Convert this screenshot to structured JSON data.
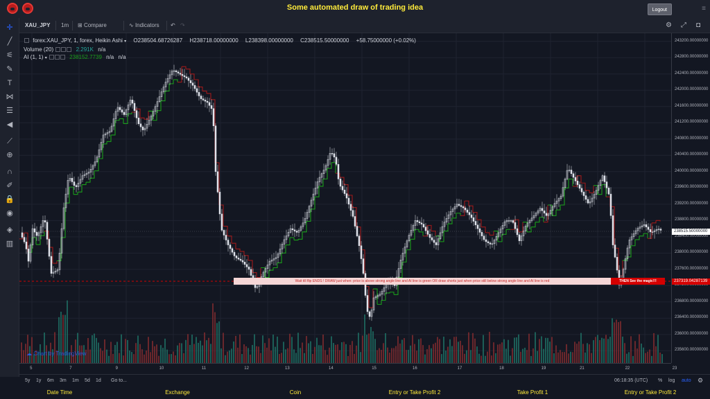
{
  "app": {
    "title": "Some automated draw of trading idea",
    "logout_label": "Logout"
  },
  "toolbar": {
    "symbol": "XAU_JPY",
    "interval": "1m",
    "compare_label": "Compare",
    "indicators_label": "Indicators"
  },
  "legend": {
    "main": "forex:XAU_JPY, 1, forex, Heikin Ashi",
    "open": "O238504.68726287",
    "high": "H238718.00000000",
    "low": "L238398.00000000",
    "close": "C238515.50000000",
    "change": "+58.75000000 (+0.02%)",
    "volume_label": "Volume (20)",
    "volume_value": "2.291K",
    "volume_na": "n/a",
    "ai_label": "AI (1, 1)",
    "ai_value": "238152.7739",
    "ai_na1": "n/a",
    "ai_na2": "n/a"
  },
  "banners": {
    "left_text": "Wait till flip ENDS !   DRAW just when:  price is above strong angle line and AI line is green        OR        draw shorts just when price still below strong angle line and AI line is red",
    "right_text": "THEN See the magic!!!",
    "price_tag": "237319.04287139"
  },
  "price_axis": {
    "ticks": [
      "243200.00000000",
      "242800.00000000",
      "242400.00000000",
      "242000.00000000",
      "241600.00000000",
      "241200.00000000",
      "240800.00000000",
      "240400.00000000",
      "240000.00000000",
      "239600.00000000",
      "239200.00000000",
      "238800.00000000",
      "238400.00000000",
      "238000.00000000",
      "237600.00000000",
      "237200.00000000",
      "236800.00000000",
      "236400.00000000",
      "236000.00000000",
      "235600.00000000"
    ],
    "current_price": "238515.50000000"
  },
  "time_axis": {
    "ticks": [
      "5",
      "7",
      "9",
      "10",
      "11",
      "12",
      "13",
      "14",
      "15",
      "16",
      "17",
      "18",
      "19",
      "21",
      "22",
      "23"
    ]
  },
  "bottombar": {
    "ranges": [
      "5y",
      "1y",
      "6m",
      "3m",
      "1m",
      "5d",
      "1d"
    ],
    "goto_label": "Go to...",
    "time": "06:18:35 (UTC)",
    "percent": "%",
    "log": "log",
    "auto": "auto"
  },
  "watermark": "Chart by TradingView",
  "footer": {
    "items": [
      "Date Time",
      "Exchange",
      "Coin",
      "Entry or Take Profit 2",
      "Take Profit 1",
      "Entry or Take Profit 2"
    ]
  },
  "colors": {
    "up": "#e0e3eb",
    "down": "#e0e3eb",
    "ai_green": "#1b9e1b",
    "ai_red": "#9e1b1b",
    "vol_up": "#26a69a",
    "vol_down": "#ef5350",
    "accent_yellow": "#ffeb3b"
  },
  "chart_data": {
    "type": "line",
    "price_path": [
      [
        0,
        238500
      ],
      [
        8,
        238200
      ],
      [
        12,
        237800
      ],
      [
        18,
        238600
      ],
      [
        25,
        238400
      ],
      [
        35,
        238900
      ],
      [
        45,
        237500
      ],
      [
        55,
        237600
      ],
      [
        62,
        239000
      ],
      [
        70,
        239900
      ],
      [
        80,
        239600
      ],
      [
        90,
        239900
      ],
      [
        100,
        240000
      ],
      [
        110,
        240300
      ],
      [
        120,
        240900
      ],
      [
        130,
        241000
      ],
      [
        140,
        241600
      ],
      [
        150,
        241400
      ],
      [
        160,
        241800
      ],
      [
        170,
        241200
      ],
      [
        178,
        241000
      ],
      [
        190,
        241400
      ],
      [
        200,
        241800
      ],
      [
        210,
        242200
      ],
      [
        220,
        242500
      ],
      [
        230,
        242400
      ],
      [
        240,
        242300
      ],
      [
        250,
        242100
      ],
      [
        260,
        241800
      ],
      [
        270,
        241700
      ],
      [
        278,
        241500
      ],
      [
        282,
        240000
      ],
      [
        285,
        239500
      ],
      [
        290,
        238600
      ],
      [
        300,
        238200
      ],
      [
        310,
        237900
      ],
      [
        320,
        237800
      ],
      [
        330,
        237600
      ],
      [
        340,
        237100
      ],
      [
        350,
        237500
      ],
      [
        360,
        237800
      ],
      [
        370,
        237900
      ],
      [
        380,
        238300
      ],
      [
        390,
        238600
      ],
      [
        400,
        238500
      ],
      [
        410,
        238800
      ],
      [
        420,
        239300
      ],
      [
        430,
        239800
      ],
      [
        440,
        240100
      ],
      [
        448,
        240500
      ],
      [
        455,
        240300
      ],
      [
        460,
        239700
      ],
      [
        470,
        239400
      ],
      [
        480,
        238900
      ],
      [
        490,
        238100
      ],
      [
        495,
        237500
      ],
      [
        500,
        236600
      ],
      [
        505,
        236400
      ],
      [
        510,
        236900
      ],
      [
        520,
        237000
      ],
      [
        530,
        237300
      ],
      [
        540,
        237200
      ],
      [
        550,
        237900
      ],
      [
        560,
        238400
      ],
      [
        570,
        238800
      ],
      [
        580,
        238700
      ],
      [
        590,
        238400
      ],
      [
        600,
        238200
      ],
      [
        610,
        238700
      ],
      [
        620,
        239000
      ],
      [
        630,
        239200
      ],
      [
        640,
        239100
      ],
      [
        650,
        238900
      ],
      [
        660,
        238600
      ],
      [
        670,
        238300
      ],
      [
        680,
        238200
      ],
      [
        690,
        238500
      ],
      [
        700,
        238800
      ],
      [
        710,
        238800
      ],
      [
        720,
        238300
      ],
      [
        730,
        238700
      ],
      [
        740,
        238900
      ],
      [
        750,
        239100
      ],
      [
        760,
        238900
      ],
      [
        770,
        239200
      ],
      [
        780,
        239400
      ],
      [
        790,
        240100
      ],
      [
        800,
        239800
      ],
      [
        810,
        239500
      ],
      [
        820,
        239200
      ],
      [
        830,
        239500
      ],
      [
        840,
        239900
      ],
      [
        850,
        239400
      ],
      [
        855,
        238200
      ],
      [
        860,
        237700
      ],
      [
        865,
        237100
      ],
      [
        870,
        237600
      ],
      [
        878,
        238300
      ],
      [
        890,
        238600
      ],
      [
        900,
        238700
      ],
      [
        910,
        238500
      ],
      [
        920,
        238600
      ],
      [
        930,
        238500
      ]
    ],
    "xlim": [
      0,
      940
    ],
    "ylim": [
      235300,
      243400
    ]
  }
}
